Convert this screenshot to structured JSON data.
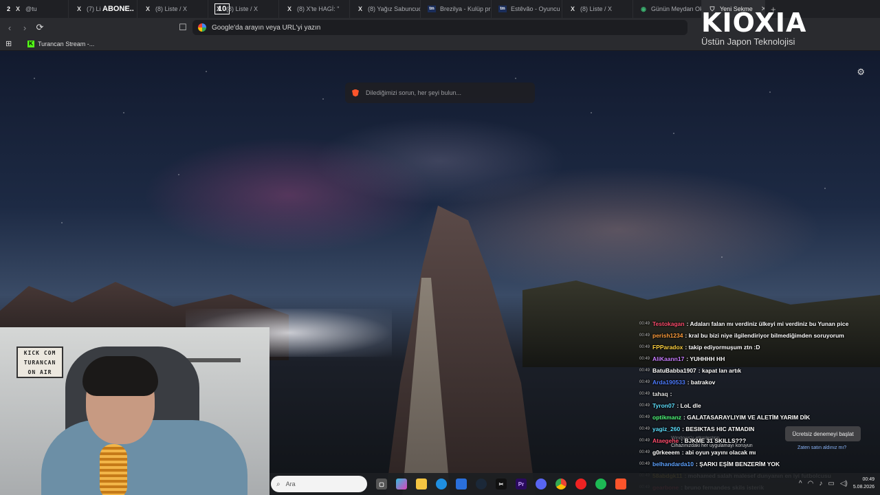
{
  "browser": {
    "tabs": [
      {
        "label": "@tu",
        "icon": "x-icon",
        "active": false,
        "badge_text": "2"
      },
      {
        "label": "(7) Li",
        "icon": "x-icon",
        "active": false
      },
      {
        "label": "(8) Liste / X",
        "icon": "x-icon",
        "active": false
      },
      {
        "label": "(8) Liste / X",
        "icon": "x-icon",
        "active": false
      },
      {
        "label": "(8) X'te HAGİ: \"",
        "icon": "x-icon",
        "active": false
      },
      {
        "label": "(8) Yağız Sabuncuo",
        "icon": "x-icon",
        "active": false
      },
      {
        "label": "Brezilya - Kulüp pr",
        "icon": "tm-icon",
        "active": false
      },
      {
        "label": "Estêvão - Oyuncu p",
        "icon": "tm-icon",
        "active": false
      },
      {
        "label": "(8) Liste / X",
        "icon": "x-icon",
        "active": false
      },
      {
        "label": "Günün Meydan Oku",
        "icon": "globe-icon",
        "active": false
      },
      {
        "label": "Yeni Sekme",
        "icon": "brave-icon",
        "active": true
      }
    ],
    "overlay_abone": "ABONE..",
    "overlay_count": "10",
    "address_placeholder": "Google'da arayın veya URL'yi yazın",
    "bookmark_label": "Turancan Stream -..."
  },
  "brand": {
    "logo": "KIOXIA",
    "tagline": "Üstün Japon Teknolojisi"
  },
  "newtab": {
    "search_placeholder": "Dilediğimizi sorun, her şeyi bulun..."
  },
  "webcam": {
    "sign_lines": [
      "KICK COM",
      "TURANCAN",
      "ON AIR"
    ]
  },
  "chat": {
    "messages": [
      {
        "time": "00:49",
        "user": "Testokagan",
        "color": "#ff4d6d",
        "text": ": Adaları falan mı verdiniz ülkeyi mi verdiniz bu Yunan pice"
      },
      {
        "time": "00:49",
        "user": "perish1234",
        "color": "#ff9d3b",
        "text": ": kral bu bizi niye ilgilendiriyor bilmediğimden soruyorum"
      },
      {
        "time": "00:49",
        "user": "FPParadox",
        "color": "#ffd23f",
        "text": ": takip ediyormuşum ztn :D"
      },
      {
        "time": "00:49",
        "user": "AliKaann17",
        "color": "#c77dff",
        "text": ": YUHHHH HH"
      },
      {
        "time": "00:49",
        "user": "BatuBabba1907",
        "color": "#ffffff",
        "text": ": kapat lan artık"
      },
      {
        "time": "00:49",
        "user": "Arda190533",
        "color": "#4d7cff",
        "text": ": batrakov"
      },
      {
        "time": "00:49",
        "user": "tahaq",
        "color": "#e0e0e0",
        "text": ":"
      },
      {
        "time": "00:49",
        "user": "Tyron07",
        "color": "#5ee0ff",
        "text": ": LoL dle"
      },
      {
        "time": "00:49",
        "user": "optikmanz",
        "color": "#50fa7b",
        "text": ": GALATASARAYLIYIM VE ALETİM YARIM DİK"
      },
      {
        "time": "00:49",
        "user": "yagiz_260",
        "color": "#5ee0ff",
        "text": ": BESIKTAS HIC ATMADIN"
      },
      {
        "time": "00:49",
        "user": "Ataegehe",
        "color": "#ff4d6d",
        "text": ": BJKME 31 SKILLS???"
      },
      {
        "time": "00:49",
        "user": "g0rkeeem",
        "color": "#ffffff",
        "text": ": abi oyun yayını olacak mı"
      },
      {
        "time": "00:49",
        "user": "belhandarda10",
        "color": "#5ea3ff",
        "text": ": ŞARKI EŞİM BENZERİM YOK"
      },
      {
        "time": "00:49",
        "user": "58abdgk11",
        "color": "#ffd23f",
        "text": ": mohamed salah malesef dunyanın en iyi futbolcusu"
      },
      {
        "time": "00:49",
        "user": "gearbone",
        "color": "#ff4d6d",
        "text": ": bruno fernandes skils isterik"
      }
    ]
  },
  "windows_note": {
    "line1": "Windows'u etkinleştirin",
    "line2": "Cihazınızdaki her uygulamayı koruyun",
    "trial_button": "Ücretsiz denemeyi başlat",
    "trial_link": "Zaten satın aldınız mı?"
  },
  "taskbar": {
    "search_placeholder": "Ara",
    "clock_time": "00:49",
    "clock_date": "5.08.2026"
  }
}
